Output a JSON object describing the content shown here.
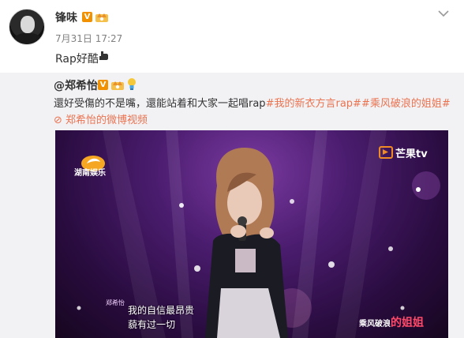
{
  "post": {
    "author": "锋味",
    "verified_badge": "V",
    "timestamp": "7月31日 17:27",
    "text": "Rap好酷",
    "hand_icon": "thumbs-down-hand-icon",
    "menu_icon": "chevron-down-icon"
  },
  "repost": {
    "author": "@郑希怡",
    "verified_badge": "V",
    "text_before": "還好受傷的不是嘴，還能站着和大家一起唱rap",
    "tags": [
      "#我的新衣方言rap#",
      "#乘风破浪的姐姐#"
    ],
    "link_icon": "link-icon",
    "link_text": "郑希怡的微博视频"
  },
  "video": {
    "channel_logo_text": "湖南娱乐",
    "platform_text": "芒果tv",
    "subtitle_tag": "郑希怡",
    "subtitle_line1": "我的自信最昂贵",
    "subtitle_line2": "藐有过一切",
    "show_logo_text": "乘风破浪",
    "show_logo_suffix": "的姐姐"
  },
  "colors": {
    "accent_orange": "#eb7350",
    "verified": "#f29100",
    "repost_bg": "#f2f2f5"
  }
}
